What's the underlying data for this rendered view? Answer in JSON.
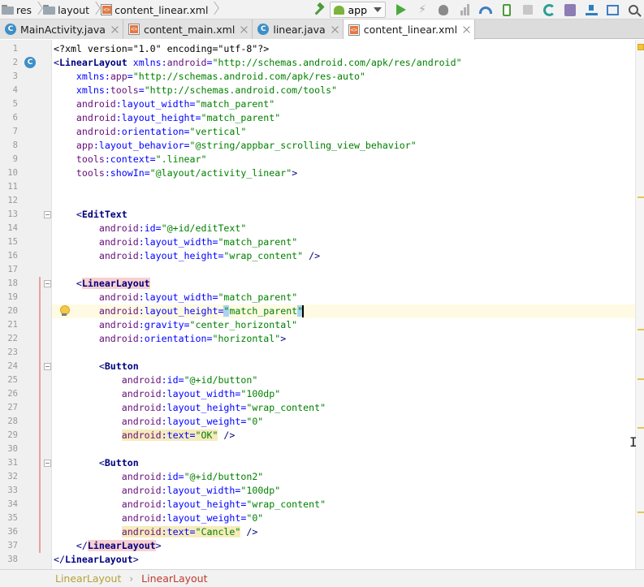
{
  "breadcrumb": [
    {
      "label": "res",
      "icon": "folder-icon"
    },
    {
      "label": "layout",
      "icon": "folder-icon"
    },
    {
      "label": "content_linear.xml",
      "icon": "xml-file-icon"
    }
  ],
  "toolbar": {
    "run_config": "app",
    "buttons": [
      "make-project-icon",
      "run-icon",
      "apply-changes-icon",
      "debug-icon",
      "attach-debugger-icon",
      "profiler-icon",
      "device-icon",
      "stop-icon",
      "sync-gradle-icon",
      "avd-manager-icon",
      "sdk-manager-icon",
      "project-structure-icon",
      "search-icon"
    ]
  },
  "tabs": [
    {
      "label": "MainActivity.java",
      "icon": "class-icon",
      "active": false
    },
    {
      "label": "content_main.xml",
      "icon": "xml-file-icon",
      "active": false
    },
    {
      "label": "linear.java",
      "icon": "class-icon",
      "active": false
    },
    {
      "label": "content_linear.xml",
      "icon": "xml-file-icon",
      "active": true
    }
  ],
  "editor": {
    "line_numbers": [
      "1",
      "2",
      "3",
      "4",
      "5",
      "6",
      "7",
      "8",
      "9",
      "10",
      "11",
      "12",
      "13",
      "14",
      "15",
      "16",
      "17",
      "18",
      "19",
      "20",
      "21",
      "22",
      "23",
      "24",
      "25",
      "26",
      "27",
      "28",
      "29",
      "30",
      "31",
      "32",
      "33",
      "34",
      "35",
      "36",
      "37",
      "38"
    ],
    "current_line": 20,
    "lines": [
      [
        {
          "t": "pi",
          "s": "<?xml version=\"1.0\" encoding=\"utf-8\"?>"
        }
      ],
      [
        {
          "t": "tag",
          "s": "<"
        },
        {
          "t": "tagname",
          "s": "LinearLayout"
        },
        {
          "t": "plain",
          "s": " "
        },
        {
          "t": "attr",
          "s": "xmlns:"
        },
        {
          "t": "ns",
          "s": "android"
        },
        {
          "t": "attr",
          "s": "="
        },
        {
          "t": "val",
          "s": "\"http://schemas.android.com/apk/res/android\""
        }
      ],
      [
        {
          "t": "plain",
          "s": "    "
        },
        {
          "t": "attr",
          "s": "xmlns:"
        },
        {
          "t": "ns",
          "s": "app"
        },
        {
          "t": "attr",
          "s": "="
        },
        {
          "t": "val",
          "s": "\"http://schemas.android.com/apk/res-auto\""
        }
      ],
      [
        {
          "t": "plain",
          "s": "    "
        },
        {
          "t": "attr",
          "s": "xmlns:"
        },
        {
          "t": "ns",
          "s": "tools"
        },
        {
          "t": "attr",
          "s": "="
        },
        {
          "t": "val",
          "s": "\"http://schemas.android.com/tools\""
        }
      ],
      [
        {
          "t": "plain",
          "s": "    "
        },
        {
          "t": "ns",
          "s": "android"
        },
        {
          "t": "attr",
          "s": ":layout_width="
        },
        {
          "t": "val",
          "s": "\"match_parent\""
        }
      ],
      [
        {
          "t": "plain",
          "s": "    "
        },
        {
          "t": "ns",
          "s": "android"
        },
        {
          "t": "attr",
          "s": ":layout_height="
        },
        {
          "t": "val",
          "s": "\"match_parent\""
        }
      ],
      [
        {
          "t": "plain",
          "s": "    "
        },
        {
          "t": "ns",
          "s": "android"
        },
        {
          "t": "attr",
          "s": ":orientation="
        },
        {
          "t": "val",
          "s": "\"vertical\""
        }
      ],
      [
        {
          "t": "plain",
          "s": "    "
        },
        {
          "t": "ns",
          "s": "app"
        },
        {
          "t": "attr",
          "s": ":layout_behavior="
        },
        {
          "t": "val",
          "s": "\"@string/appbar_scrolling_view_behavior\""
        }
      ],
      [
        {
          "t": "plain",
          "s": "    "
        },
        {
          "t": "ns",
          "s": "tools"
        },
        {
          "t": "attr",
          "s": ":context="
        },
        {
          "t": "val",
          "s": "\".linear\""
        }
      ],
      [
        {
          "t": "plain",
          "s": "    "
        },
        {
          "t": "ns",
          "s": "tools"
        },
        {
          "t": "attr",
          "s": ":showIn="
        },
        {
          "t": "val",
          "s": "\"@layout/activity_linear\""
        },
        {
          "t": "tag",
          "s": ">"
        }
      ],
      [],
      [],
      [
        {
          "t": "plain",
          "s": "    "
        },
        {
          "t": "tag",
          "s": "<"
        },
        {
          "t": "tagname",
          "s": "EditText"
        }
      ],
      [
        {
          "t": "plain",
          "s": "        "
        },
        {
          "t": "ns",
          "s": "android"
        },
        {
          "t": "attr",
          "s": ":id="
        },
        {
          "t": "val",
          "s": "\"@+id/editText\""
        }
      ],
      [
        {
          "t": "plain",
          "s": "        "
        },
        {
          "t": "ns",
          "s": "android"
        },
        {
          "t": "attr",
          "s": ":layout_width="
        },
        {
          "t": "val",
          "s": "\"match_parent\""
        }
      ],
      [
        {
          "t": "plain",
          "s": "        "
        },
        {
          "t": "ns",
          "s": "android"
        },
        {
          "t": "attr",
          "s": ":layout_height="
        },
        {
          "t": "val",
          "s": "\"wrap_content\""
        },
        {
          "t": "tag",
          "s": " />"
        }
      ],
      [],
      [
        {
          "t": "plain",
          "s": "    "
        },
        {
          "t": "tag",
          "s": "<"
        },
        {
          "t": "tagname-pair",
          "s": "LinearLayout"
        }
      ],
      [
        {
          "t": "plain",
          "s": "        "
        },
        {
          "t": "ns",
          "s": "android"
        },
        {
          "t": "attr",
          "s": ":layout_width="
        },
        {
          "t": "val",
          "s": "\"match_parent\""
        }
      ],
      [
        {
          "t": "plain",
          "s": "        "
        },
        {
          "t": "ns",
          "s": "android"
        },
        {
          "t": "attr",
          "s": ":layout_height="
        },
        {
          "t": "val-sel",
          "s": "\""
        },
        {
          "t": "val",
          "s": "match_parent"
        },
        {
          "t": "val-sel",
          "s": "\""
        }
      ],
      [
        {
          "t": "plain",
          "s": "        "
        },
        {
          "t": "ns",
          "s": "android"
        },
        {
          "t": "attr",
          "s": ":gravity="
        },
        {
          "t": "val",
          "s": "\"center_horizontal\""
        }
      ],
      [
        {
          "t": "plain",
          "s": "        "
        },
        {
          "t": "ns",
          "s": "android"
        },
        {
          "t": "attr",
          "s": ":orientation="
        },
        {
          "t": "val",
          "s": "\"horizontal\""
        },
        {
          "t": "tag",
          "s": ">"
        }
      ],
      [],
      [
        {
          "t": "plain",
          "s": "        "
        },
        {
          "t": "tag",
          "s": "<"
        },
        {
          "t": "tagname",
          "s": "Button"
        }
      ],
      [
        {
          "t": "plain",
          "s": "            "
        },
        {
          "t": "ns",
          "s": "android"
        },
        {
          "t": "attr",
          "s": ":id="
        },
        {
          "t": "val",
          "s": "\"@+id/button\""
        }
      ],
      [
        {
          "t": "plain",
          "s": "            "
        },
        {
          "t": "ns",
          "s": "android"
        },
        {
          "t": "attr",
          "s": ":layout_width="
        },
        {
          "t": "val",
          "s": "\"100dp\""
        }
      ],
      [
        {
          "t": "plain",
          "s": "            "
        },
        {
          "t": "ns",
          "s": "android"
        },
        {
          "t": "attr",
          "s": ":layout_height="
        },
        {
          "t": "val",
          "s": "\"wrap_content\""
        }
      ],
      [
        {
          "t": "plain",
          "s": "            "
        },
        {
          "t": "ns",
          "s": "android"
        },
        {
          "t": "attr",
          "s": ":layout_weight="
        },
        {
          "t": "val",
          "s": "\"0\""
        }
      ],
      [
        {
          "t": "plain",
          "s": "            "
        },
        {
          "t": "ns-warn",
          "s": "android"
        },
        {
          "t": "attr-warn",
          "s": ":text="
        },
        {
          "t": "val-warn",
          "s": "\"OK\""
        },
        {
          "t": "tag",
          "s": " />"
        }
      ],
      [],
      [
        {
          "t": "plain",
          "s": "        "
        },
        {
          "t": "tag",
          "s": "<"
        },
        {
          "t": "tagname",
          "s": "Button"
        }
      ],
      [
        {
          "t": "plain",
          "s": "            "
        },
        {
          "t": "ns",
          "s": "android"
        },
        {
          "t": "attr",
          "s": ":id="
        },
        {
          "t": "val",
          "s": "\"@+id/button2\""
        }
      ],
      [
        {
          "t": "plain",
          "s": "            "
        },
        {
          "t": "ns",
          "s": "android"
        },
        {
          "t": "attr",
          "s": ":layout_width="
        },
        {
          "t": "val",
          "s": "\"100dp\""
        }
      ],
      [
        {
          "t": "plain",
          "s": "            "
        },
        {
          "t": "ns",
          "s": "android"
        },
        {
          "t": "attr",
          "s": ":layout_height="
        },
        {
          "t": "val",
          "s": "\"wrap_content\""
        }
      ],
      [
        {
          "t": "plain",
          "s": "            "
        },
        {
          "t": "ns",
          "s": "android"
        },
        {
          "t": "attr",
          "s": ":layout_weight="
        },
        {
          "t": "val",
          "s": "\"0\""
        }
      ],
      [
        {
          "t": "plain",
          "s": "            "
        },
        {
          "t": "ns-warn",
          "s": "android"
        },
        {
          "t": "attr-warn",
          "s": ":text="
        },
        {
          "t": "val-warn",
          "s": "\"Cancle\""
        },
        {
          "t": "tag",
          "s": " />"
        }
      ],
      [
        {
          "t": "plain",
          "s": "    "
        },
        {
          "t": "tag",
          "s": "</"
        },
        {
          "t": "tagname-pair",
          "s": "LinearLayout"
        },
        {
          "t": "tag",
          "s": ">"
        }
      ],
      [
        {
          "t": "tag",
          "s": "</"
        },
        {
          "t": "tagname",
          "s": "LinearLayout"
        },
        {
          "t": "tag",
          "s": ">"
        }
      ]
    ]
  },
  "status_breadcrumb": [
    "LinearLayout",
    "LinearLayout"
  ],
  "colors": {
    "tag": "#000080",
    "attribute": "#0000ff",
    "namespace": "#660e7a",
    "value": "#008000",
    "current_line": "#fffae3",
    "warning": "#f6ebbc",
    "tag_pair": "#f9d0d0",
    "run_green": "#4caa3c"
  }
}
